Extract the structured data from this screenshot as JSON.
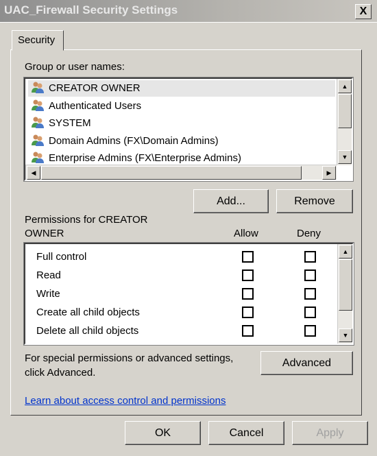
{
  "window": {
    "title": "UAC_Firewall Security Settings",
    "close_label": "X"
  },
  "tabs": [
    {
      "label": "Security",
      "active": true
    }
  ],
  "groups": {
    "label": "Group or user names:",
    "items": [
      {
        "name": "CREATOR OWNER",
        "selected": true,
        "icon": "users-icon"
      },
      {
        "name": "Authenticated Users",
        "selected": false,
        "icon": "users-icon"
      },
      {
        "name": "SYSTEM",
        "selected": false,
        "icon": "users-icon"
      },
      {
        "name": "Domain Admins (FX\\Domain Admins)",
        "selected": false,
        "icon": "users-icon"
      },
      {
        "name": "Enterprise Admins (FX\\Enterprise Admins)",
        "selected": false,
        "icon": "users-icon"
      }
    ]
  },
  "buttons": {
    "add": "Add...",
    "remove": "Remove",
    "advanced": "Advanced",
    "ok": "OK",
    "cancel": "Cancel",
    "apply": "Apply"
  },
  "permissions": {
    "label_line1": "Permissions for CREATOR",
    "label_line2": "OWNER",
    "allow_header": "Allow",
    "deny_header": "Deny",
    "items": [
      {
        "name": "Full control",
        "allow": false,
        "deny": false
      },
      {
        "name": "Read",
        "allow": false,
        "deny": false
      },
      {
        "name": "Write",
        "allow": false,
        "deny": false
      },
      {
        "name": "Create all child objects",
        "allow": false,
        "deny": false
      },
      {
        "name": "Delete all child objects",
        "allow": false,
        "deny": false
      }
    ]
  },
  "special": {
    "line1": "For special permissions or advanced settings,",
    "line2": "click Advanced."
  },
  "link": "Learn about access control and permissions"
}
